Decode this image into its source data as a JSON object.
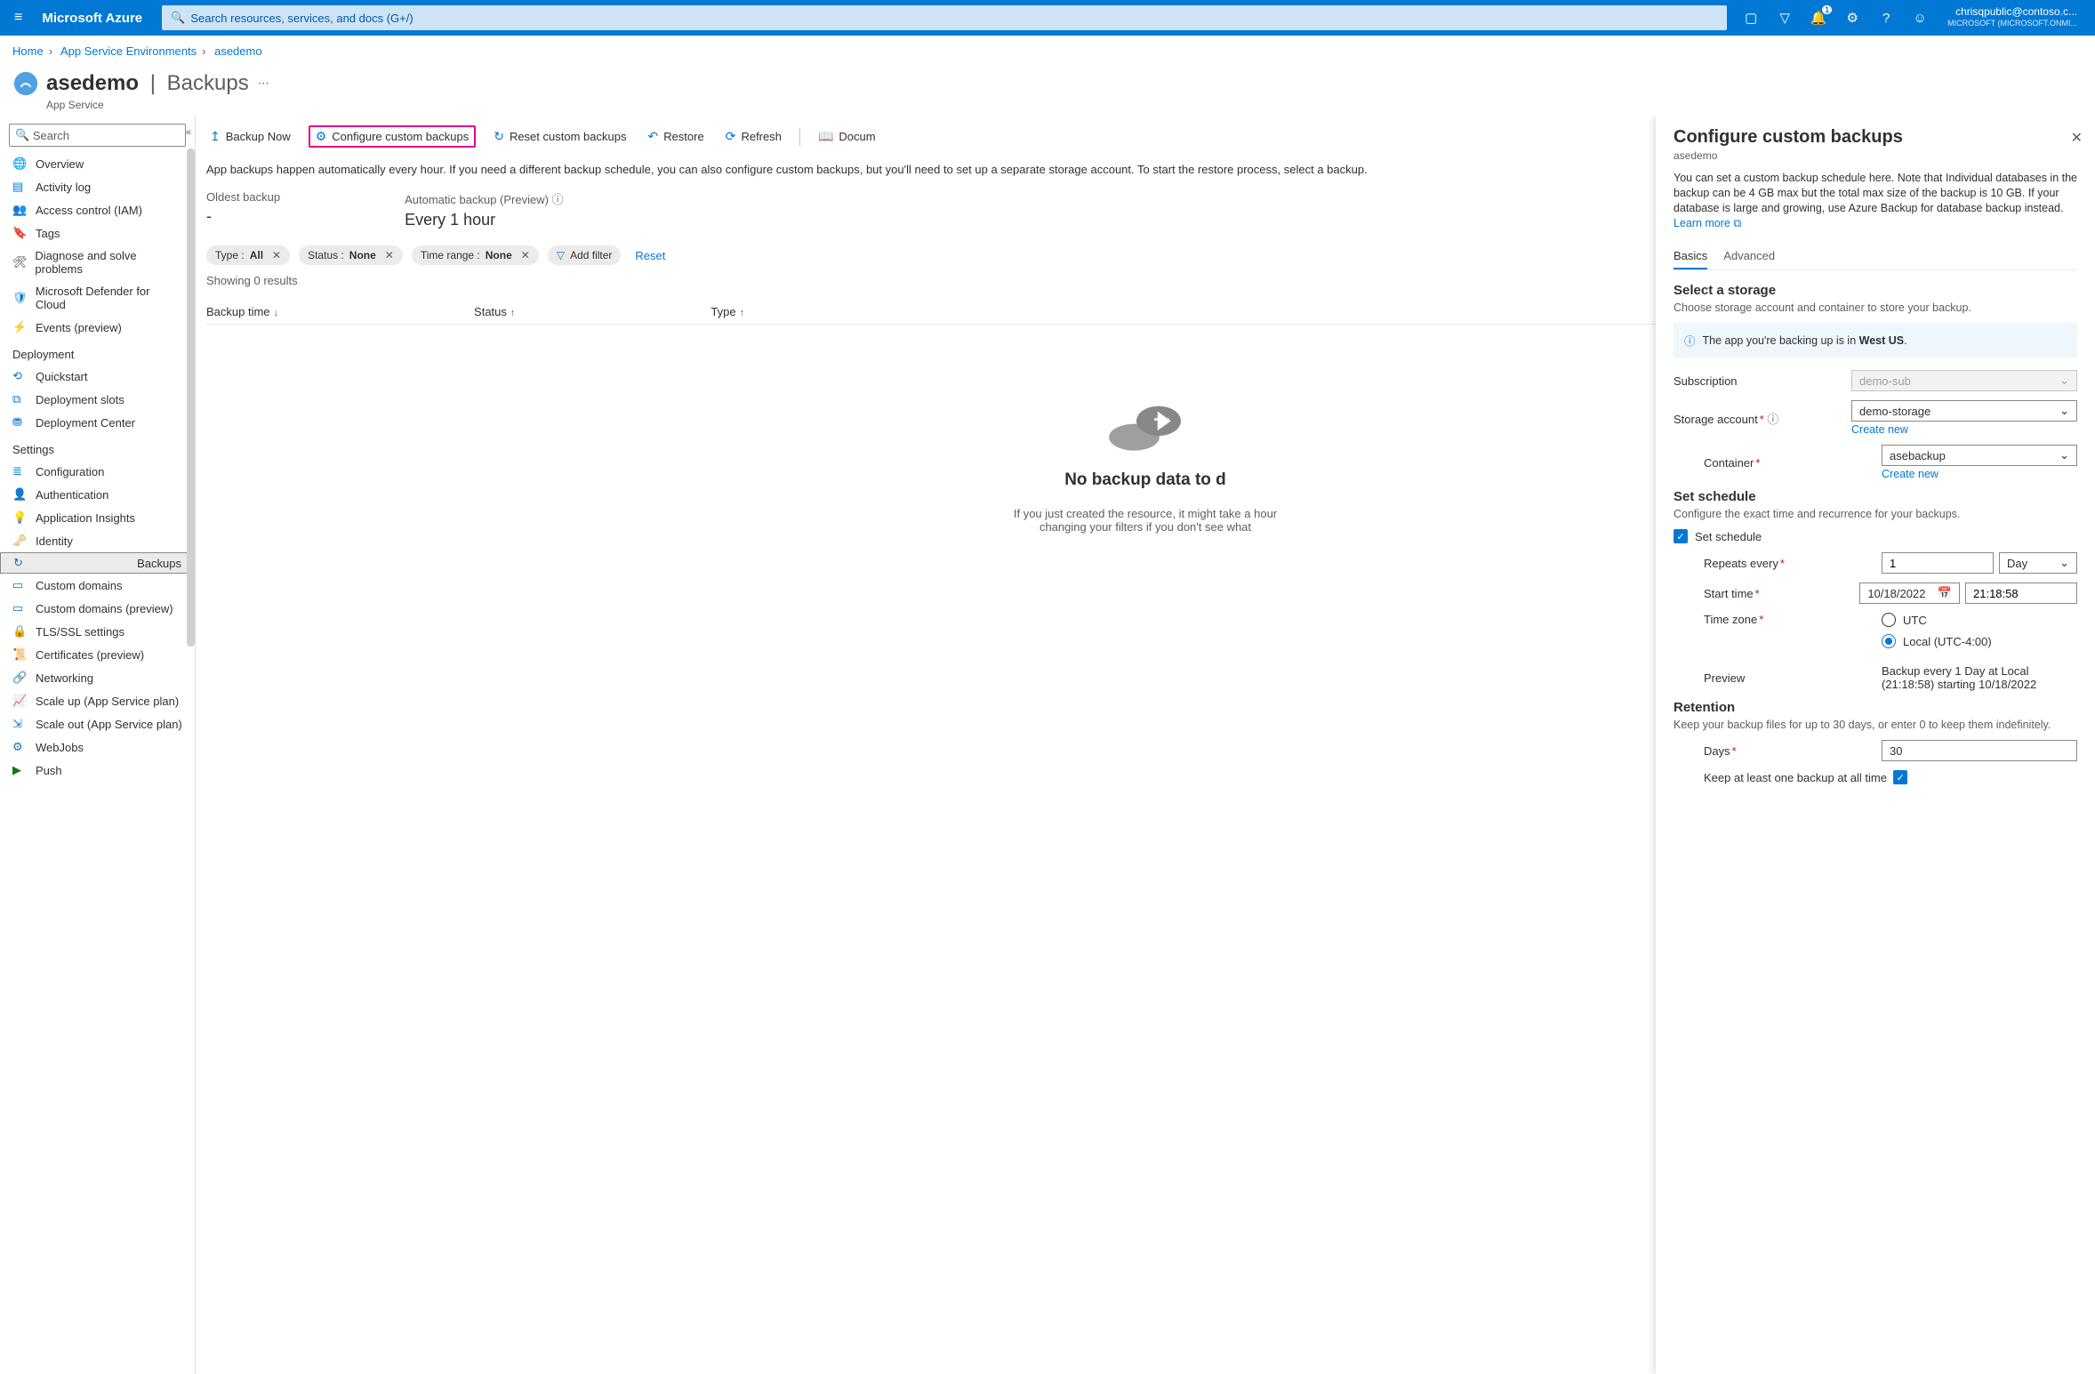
{
  "topbar": {
    "brand": "Microsoft Azure",
    "search_placeholder": "Search resources, services, and docs (G+/)",
    "notif_badge": "1",
    "account_line1": "chrisqpublic@contoso.c...",
    "account_line2": "MICROSOFT (MICROSOFT.ONMI..."
  },
  "breadcrumb": {
    "home": "Home",
    "env": "App Service Environments",
    "res": "asedemo"
  },
  "page": {
    "title_main": "asedemo",
    "title_sub": "Backups",
    "subtitle": "App Service"
  },
  "sidebar": {
    "search": "Search",
    "items": [
      "Overview",
      "Activity log",
      "Access control (IAM)",
      "Tags",
      "Diagnose and solve problems",
      "Microsoft Defender for Cloud",
      "Events (preview)"
    ],
    "group_deploy": "Deployment",
    "deploy": [
      "Quickstart",
      "Deployment slots",
      "Deployment Center"
    ],
    "group_settings": "Settings",
    "settings": [
      "Configuration",
      "Authentication",
      "Application Insights",
      "Identity",
      "Backups",
      "Custom domains",
      "Custom domains (preview)",
      "TLS/SSL settings",
      "Certificates (preview)",
      "Networking",
      "Scale up (App Service plan)",
      "Scale out (App Service plan)",
      "WebJobs",
      "Push"
    ]
  },
  "toolbar": {
    "backup_now": "Backup Now",
    "configure": "Configure custom backups",
    "reset": "Reset custom backups",
    "restore": "Restore",
    "refresh": "Refresh",
    "docs": "Docum"
  },
  "intro": "App backups happen automatically every hour. If you need a different backup schedule, you can also configure custom backups, but you'll need to set up a separate storage account. To start the restore process, select a backup.",
  "stats": {
    "oldest_label": "Oldest backup",
    "oldest_value": "-",
    "auto_label": "Automatic backup (Preview)",
    "auto_value": "Every 1 hour"
  },
  "filters": {
    "type_lbl": "Type : ",
    "type_val": "All",
    "status_lbl": "Status : ",
    "status_val": "None",
    "time_lbl": "Time range : ",
    "time_val": "None",
    "add": "Add filter",
    "reset": "Reset"
  },
  "showing": "Showing 0 results",
  "cols": {
    "c1": "Backup time",
    "c2": "Status",
    "c3": "Type"
  },
  "empty": {
    "title": "No backup data to d",
    "body1": "If you just created the resource, it might take a hour ",
    "body2": "changing your filters if you don't see what "
  },
  "panel": {
    "title": "Configure custom backups",
    "sub": "asedemo",
    "desc": "You can set a custom backup schedule here. Note that Individual databases in the backup can be 4 GB max but the total max size of the backup is 10 GB. If your database is large and growing, use Azure Backup for database backup instead. ",
    "learn": "Learn more",
    "tab_basics": "Basics",
    "tab_adv": "Advanced",
    "storage_h": "Select a storage",
    "storage_hint": "Choose storage account and container to store your backup.",
    "info_pre": "The app you're backing up is in ",
    "info_loc": "West US",
    "info_post": ".",
    "subscription_lbl": "Subscription",
    "subscription_val": "demo-sub",
    "stor_lbl": "Storage account",
    "stor_val": "demo-storage",
    "create_new": "Create new",
    "cont_lbl": "Container",
    "cont_val": "asebackup",
    "sched_h": "Set schedule",
    "sched_hint": "Configure the exact time and recurrence for your backups.",
    "set_sched": "Set schedule",
    "repeats_lbl": "Repeats every",
    "repeats_num": "1",
    "repeats_unit": "Day",
    "start_lbl": "Start time",
    "start_date": "10/18/2022",
    "start_time": "21:18:58",
    "tz_lbl": "Time zone",
    "tz_utc": "UTC",
    "tz_local": "Local (UTC-4:00)",
    "preview_lbl": "Preview",
    "preview_val": "Backup every 1 Day at Local (21:18:58) starting 10/18/2022",
    "ret_h": "Retention",
    "ret_hint": "Keep your backup files for up to 30 days, or enter 0 to keep them indefinitely.",
    "days_lbl": "Days",
    "days_val": "30",
    "keep_lbl": "Keep at least one backup at all time"
  }
}
